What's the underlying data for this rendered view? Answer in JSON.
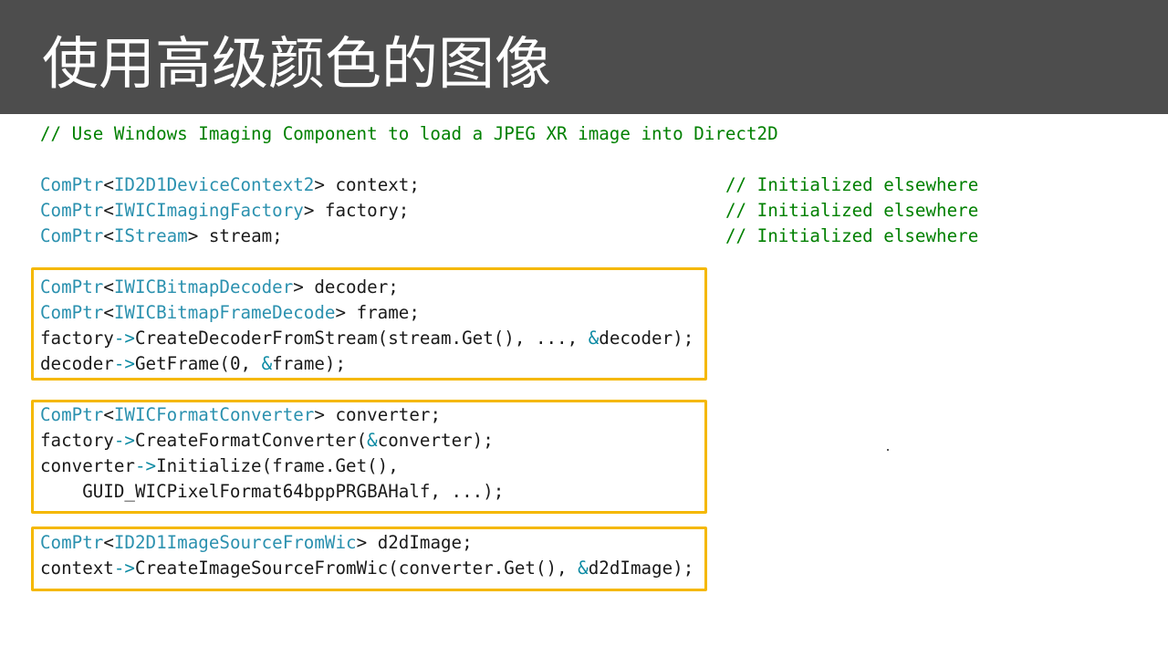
{
  "slide": {
    "title": "使用高级颜色的图像"
  },
  "code": {
    "comment_header": "// Use Windows Imaging Component to load a JPEG XR image into Direct2D",
    "lines": {
      "context_decl": {
        "tmpl": "ComPtr",
        "lt": "<",
        "type": "ID2D1DeviceContext2",
        "gt": ">",
        "rest": " context;",
        "comment": "// Initialized elsewhere"
      },
      "factory_decl": {
        "tmpl": "ComPtr",
        "lt": "<",
        "type": "IWICImagingFactory",
        "gt": ">",
        "rest": " factory;",
        "comment": "// Initialized elsewhere"
      },
      "stream_decl": {
        "tmpl": "ComPtr",
        "lt": "<",
        "type": "IStream",
        "gt": ">",
        "rest": " stream;",
        "comment": "// Initialized elsewhere"
      },
      "decoder_decl": {
        "tmpl": "ComPtr",
        "lt": "<",
        "type": "IWICBitmapDecoder",
        "gt": ">",
        "rest": " decoder;"
      },
      "frame_decl": {
        "tmpl": "ComPtr",
        "lt": "<",
        "type": "IWICBitmapFrameDecode",
        "gt": ">",
        "rest": " frame;"
      },
      "create_decoder": {
        "obj": "factory",
        "arrow": "->",
        "call": "CreateDecoderFromStream(stream.Get(), ..., ",
        "amp": "&",
        "rest": "decoder);"
      },
      "get_frame": {
        "obj": "decoder",
        "arrow": "->",
        "call": "GetFrame(0, ",
        "amp": "&",
        "rest": "frame);"
      },
      "converter_decl": {
        "tmpl": "ComPtr",
        "lt": "<",
        "type": "IWICFormatConverter",
        "gt": ">",
        "rest": " converter;"
      },
      "create_converter": {
        "obj": "factory",
        "arrow": "->",
        "call": "CreateFormatConverter(",
        "amp": "&",
        "rest": "converter);"
      },
      "initialize": {
        "obj": "converter",
        "arrow": "->",
        "call": "Initialize(frame.Get(),",
        "amp": "",
        "rest": ""
      },
      "pixel_format": {
        "text": "    GUID_WICPixelFormat64bppPRGBAHalf, ...);"
      },
      "image_decl": {
        "tmpl": "ComPtr",
        "lt": "<",
        "type": "ID2D1ImageSourceFromWic",
        "gt": ">",
        "rest": " d2dImage;"
      },
      "create_image": {
        "obj": "context",
        "arrow": "->",
        "call": "CreateImageSourceFromWic(converter.Get(), ",
        "amp": "&",
        "rest": "d2dImage);"
      }
    }
  },
  "colors": {
    "header_bg": "#4d4d4d",
    "comment": "#008000",
    "type": "#2b91af",
    "highlight_box": "#f5b800"
  }
}
